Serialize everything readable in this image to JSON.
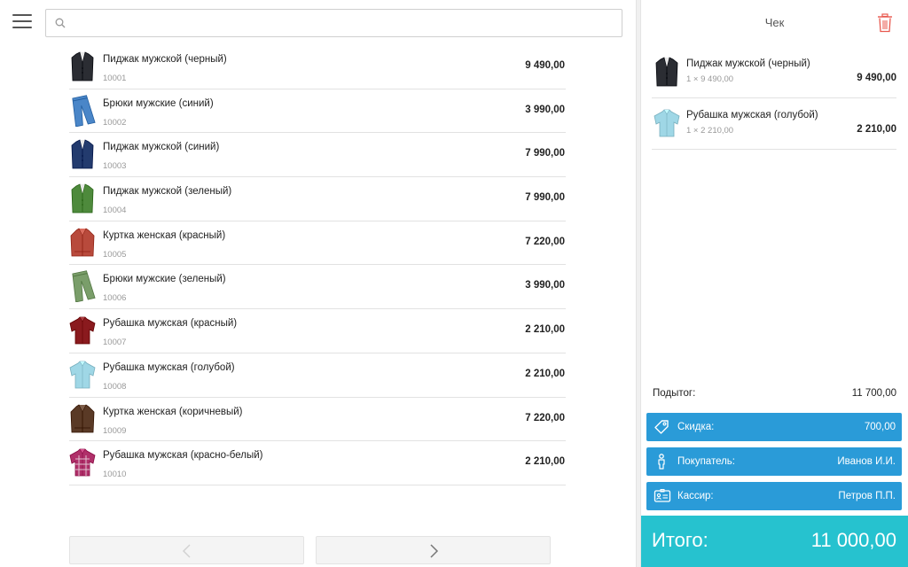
{
  "search": {
    "value": "",
    "placeholder": ""
  },
  "products": [
    {
      "name": "Пиджак мужской (черный)",
      "code": "10001",
      "price": "9 490,00",
      "icon": "jacket-icon",
      "color": "#2b2d33"
    },
    {
      "name": "Брюки мужские (синий)",
      "code": "10002",
      "price": "3 990,00",
      "icon": "trousers-icon",
      "color": "#4a86c8"
    },
    {
      "name": "Пиджак мужской (синий)",
      "code": "10003",
      "price": "7 990,00",
      "icon": "jacket-icon",
      "color": "#233b6e"
    },
    {
      "name": "Пиджак мужской (зеленый)",
      "code": "10004",
      "price": "7 990,00",
      "icon": "jacket-icon",
      "color": "#4e8a3c"
    },
    {
      "name": "Куртка женская (красный)",
      "code": "10005",
      "price": "7 220,00",
      "icon": "leather-jacket-icon",
      "color": "#b84a3c"
    },
    {
      "name": "Брюки мужские (зеленый)",
      "code": "10006",
      "price": "3 990,00",
      "icon": "trousers-icon",
      "color": "#7a9e6a"
    },
    {
      "name": "Рубашка мужская (красный)",
      "code": "10007",
      "price": "2 210,00",
      "icon": "shirt-icon",
      "color": "#8a1a1e"
    },
    {
      "name": "Рубашка мужская (голубой)",
      "code": "10008",
      "price": "2 210,00",
      "icon": "shirt-icon",
      "color": "#9fd7e6"
    },
    {
      "name": "Куртка женская (коричневый)",
      "code": "10009",
      "price": "7 220,00",
      "icon": "leather-jacket-icon",
      "color": "#5a3a26"
    },
    {
      "name": "Рубашка мужская (красно-белый)",
      "code": "10010",
      "price": "2 210,00",
      "icon": "plaid-shirt-icon",
      "color": "#b0306a"
    }
  ],
  "receipt": {
    "title": "Чек",
    "items": [
      {
        "name": "Пиджак мужской (черный)",
        "qty": "1 × 9 490,00",
        "sum": "9 490,00",
        "icon": "jacket-icon",
        "color": "#2b2d33"
      },
      {
        "name": "Рубашка мужская (голубой)",
        "qty": "1 × 2 210,00",
        "sum": "2 210,00",
        "icon": "shirt-icon",
        "color": "#9fd7e6"
      }
    ],
    "subtotal_label": "Подытог:",
    "subtotal_value": "11 700,00",
    "discount_label": "Скидка:",
    "discount_value": "700,00",
    "customer_label": "Покупатель:",
    "customer_value": "Иванов И.И.",
    "cashier_label": "Кассир:",
    "cashier_value": "Петров П.П.",
    "total_label": "Итого:",
    "total_value": "11 000,00"
  },
  "colors": {
    "action_blue": "#2a9bd8",
    "total_teal": "#26c2cf",
    "trash_red": "#e8594f"
  }
}
